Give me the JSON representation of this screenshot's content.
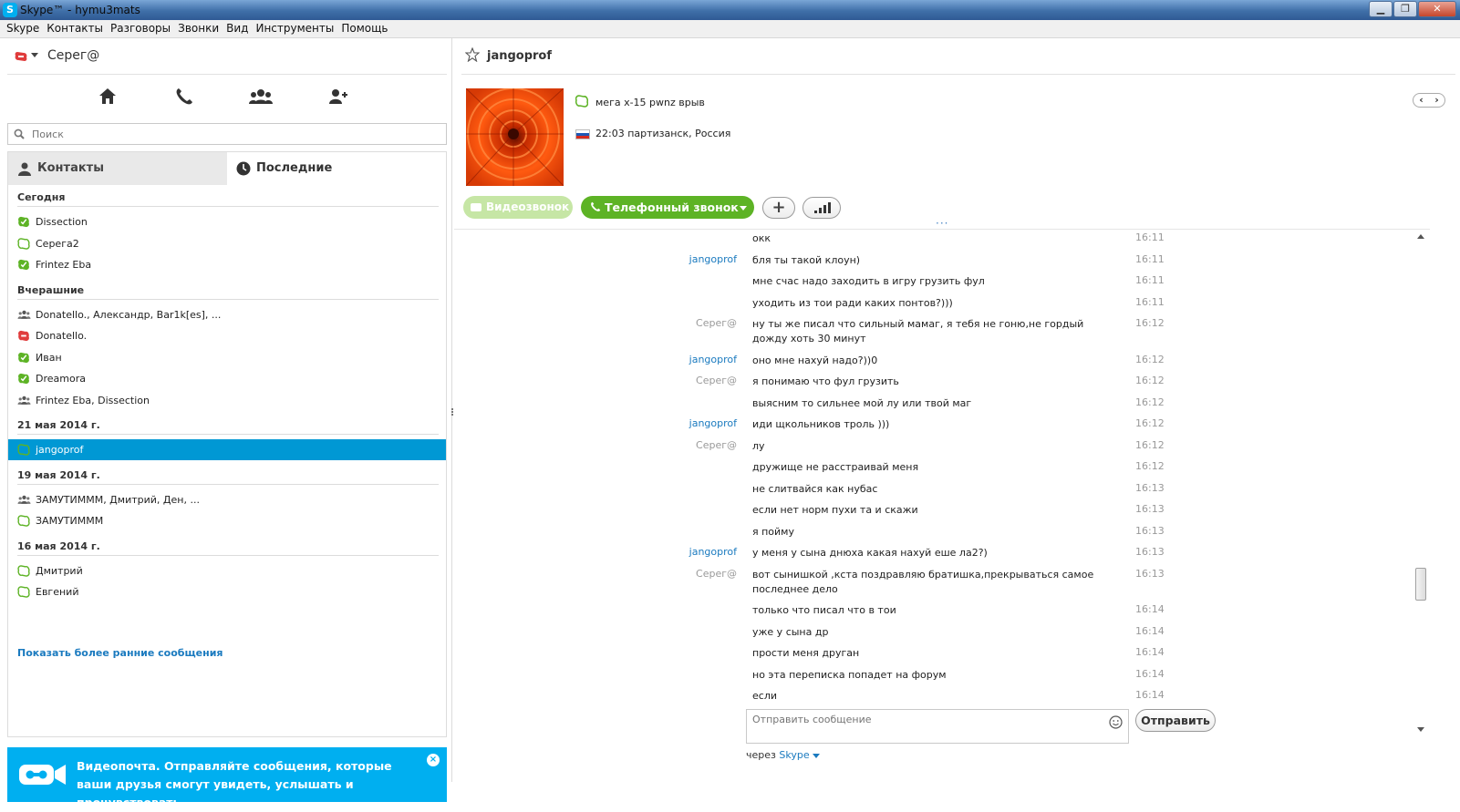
{
  "window": {
    "title": "Skype™ - hymu3mats"
  },
  "menu": [
    "Skype",
    "Контакты",
    "Разговоры",
    "Звонки",
    "Вид",
    "Инструменты",
    "Помощь"
  ],
  "profile": {
    "name": "Серег@"
  },
  "search": {
    "placeholder": "Поиск"
  },
  "tabs": {
    "contacts": "Контакты",
    "recent": "Последние"
  },
  "recent": {
    "groups": [
      {
        "title": "Сегодня",
        "items": [
          {
            "name": "Dissection",
            "status": "online"
          },
          {
            "name": "Серега2",
            "status": "offline"
          },
          {
            "name": "Frintez Eba",
            "status": "online"
          }
        ]
      },
      {
        "title": "Вчерашние",
        "items": [
          {
            "name": "Donatello., Александр, Bar1k[es], ...",
            "status": "group"
          },
          {
            "name": "Donatello.",
            "status": "dnd"
          },
          {
            "name": "Иван",
            "status": "online"
          },
          {
            "name": "Dreamora",
            "status": "online"
          },
          {
            "name": "Frintez Eba, Dissection",
            "status": "group"
          }
        ]
      },
      {
        "title": "21 мая 2014 г.",
        "items": [
          {
            "name": "jangoprof",
            "status": "offline",
            "selected": true
          }
        ]
      },
      {
        "title": "19 мая 2014 г.",
        "items": [
          {
            "name": "ЗАМУТИМММ, Дмитрий, Ден, ...",
            "status": "group"
          },
          {
            "name": "ЗАМУТИМММ",
            "status": "offline"
          }
        ]
      },
      {
        "title": "16 мая 2014 г.",
        "items": [
          {
            "name": "Дмитрий",
            "status": "offline"
          },
          {
            "name": "Евгений",
            "status": "offline"
          }
        ]
      }
    ],
    "show_more": "Показать более ранние сообщения"
  },
  "promo": {
    "text": "Видеопочта. Отправляйте сообщения, которые ваши друзья смогут увидеть, услышать и прочувствовать.",
    "close": "×"
  },
  "conversation": {
    "name": "jangoprof",
    "mood": "мега х-15 pwnz врыв",
    "location": "22:03 партизанск, Россия",
    "video_call": "Видеозвонок",
    "phone_call": "Телефонный звонок",
    "add": "+",
    "nav_prev": "‹",
    "nav_next": "›",
    "more_dots": "···"
  },
  "messages": [
    {
      "sender": "",
      "text": "окк",
      "time": "16:11"
    },
    {
      "sender": "jangoprof",
      "who": "them",
      "text": "бля ты такой клоун)",
      "time": "16:11"
    },
    {
      "sender": "",
      "text": "мне счас надо заходить в игру грузить фул",
      "time": "16:11"
    },
    {
      "sender": "",
      "text": "уходить из тои ради каких понтов?)))",
      "time": "16:11"
    },
    {
      "sender": "Серег@",
      "who": "me",
      "text": "ну ты же писал что сильный мамаг, я тебя не гоню,не гордый дожду хоть 30 минут",
      "time": "16:12"
    },
    {
      "sender": "jangoprof",
      "who": "them",
      "text": "оно мне нахуй надо?))0",
      "time": "16:12"
    },
    {
      "sender": "Серег@",
      "who": "me",
      "text": "я понимаю что фул грузить",
      "time": "16:12"
    },
    {
      "sender": "",
      "text": "выясним то сильнее мой лу или твой маг",
      "time": "16:12"
    },
    {
      "sender": "jangoprof",
      "who": "them",
      "text": "иди щкольников троль )))",
      "time": "16:12"
    },
    {
      "sender": "Серег@",
      "who": "me",
      "text": "лу",
      "time": "16:12"
    },
    {
      "sender": "",
      "text": "дружище не расстраивай меня",
      "time": "16:12"
    },
    {
      "sender": "",
      "text": "не слитвайся как нубас",
      "time": "16:13"
    },
    {
      "sender": "",
      "text": "если нет норм пухи та и скажи",
      "time": "16:13"
    },
    {
      "sender": "",
      "text": "я пойму",
      "time": "16:13"
    },
    {
      "sender": "jangoprof",
      "who": "them",
      "text": "у меня у сына днюха какая нахуй еше ла2?)",
      "time": "16:13"
    },
    {
      "sender": "Серег@",
      "who": "me",
      "text": "вот сынишкой ,кста поздравляю братишка,прекрываться самое последнее дело",
      "time": "16:13"
    },
    {
      "sender": "",
      "text": "только что писал что в тои",
      "time": "16:14"
    },
    {
      "sender": "",
      "text": "уже у сына др",
      "time": "16:14"
    },
    {
      "sender": "",
      "text": "прости меня друган",
      "time": "16:14"
    },
    {
      "sender": "",
      "text": "но эта переписка попадет на форум",
      "time": "16:14"
    },
    {
      "sender": "",
      "text": "если",
      "time": "16:14"
    }
  ],
  "composer": {
    "placeholder": "Отправить сообщение",
    "send": "Отправить",
    "via_prefix": "через",
    "via_link": "Skype"
  },
  "colors": {
    "accent": "#00aff0",
    "online": "#5db325",
    "selected": "#0098d4",
    "link": "#1a7abf",
    "dnd": "#e03c3c"
  }
}
